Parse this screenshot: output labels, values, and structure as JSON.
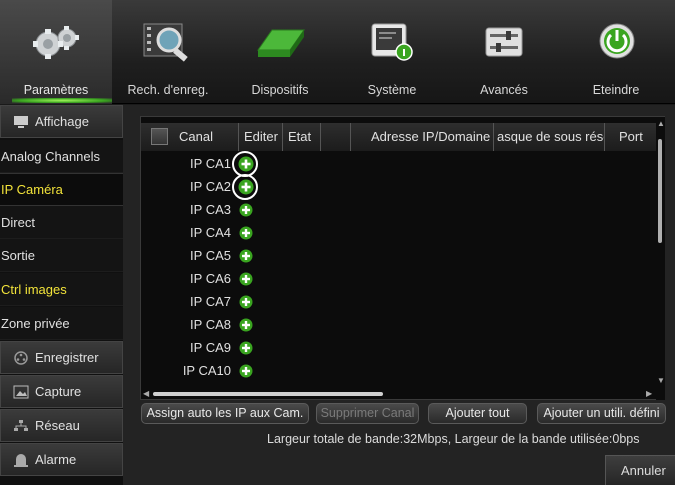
{
  "toolbar": {
    "items": [
      {
        "label": "Paramètres",
        "icon": "gears-icon"
      },
      {
        "label": "Rech. d'enreg.",
        "icon": "search-film-icon"
      },
      {
        "label": "Dispositifs",
        "icon": "hard-disk-icon"
      },
      {
        "label": "Système",
        "icon": "system-info-icon"
      },
      {
        "label": "Avancés",
        "icon": "sliders-icon"
      },
      {
        "label": "Eteindre",
        "icon": "power-icon"
      }
    ],
    "active": "Paramètres",
    "accent": "#3aa520"
  },
  "sidebar": {
    "items": [
      {
        "label": "Affichage",
        "type": "category",
        "icon": "monitor-icon"
      },
      {
        "label": "Analog Channels",
        "type": "sub"
      },
      {
        "label": "IP Caméra",
        "type": "sub",
        "selected": true
      },
      {
        "label": "Direct",
        "type": "sub"
      },
      {
        "label": "Sortie",
        "type": "sub"
      },
      {
        "label": "Ctrl images",
        "type": "sub",
        "highlight": true
      },
      {
        "label": "Zone privée",
        "type": "sub"
      },
      {
        "label": "Enregistrer",
        "type": "category",
        "icon": "film-reel-icon"
      },
      {
        "label": "Capture",
        "type": "category",
        "icon": "picture-icon"
      },
      {
        "label": "Réseau",
        "type": "category",
        "icon": "network-icon"
      },
      {
        "label": "Alarme",
        "type": "category",
        "icon": "alarm-icon"
      }
    ],
    "highlight_color": "#f2e33a"
  },
  "table": {
    "columns": [
      "Canal",
      "Editer",
      "Etat",
      "",
      "Adresse IP/Domaine",
      "asque de sous résea",
      "Port"
    ],
    "rows": [
      {
        "channel": "IP CA1",
        "circled": true
      },
      {
        "channel": "IP CA2",
        "circled": true
      },
      {
        "channel": "IP CA3"
      },
      {
        "channel": "IP CA4"
      },
      {
        "channel": "IP CA5"
      },
      {
        "channel": "IP CA6"
      },
      {
        "channel": "IP CA7"
      },
      {
        "channel": "IP CA8"
      },
      {
        "channel": "IP CA9"
      },
      {
        "channel": "IP CA10"
      }
    ],
    "add_icon": "add-circle-icon",
    "add_color": "#3aa520"
  },
  "buttons": {
    "auto_assign": "Assign auto les IP aux Cam.",
    "delete_channel": "Supprimer Canal",
    "add_all": "Ajouter tout",
    "add_user_defined": "Ajouter un utili. défini"
  },
  "status": {
    "bandwidth": "Largeur totale de bande:32Mbps,  Largeur de la bande utilisée:0bps"
  },
  "footer": {
    "cancel": "Annuler"
  }
}
